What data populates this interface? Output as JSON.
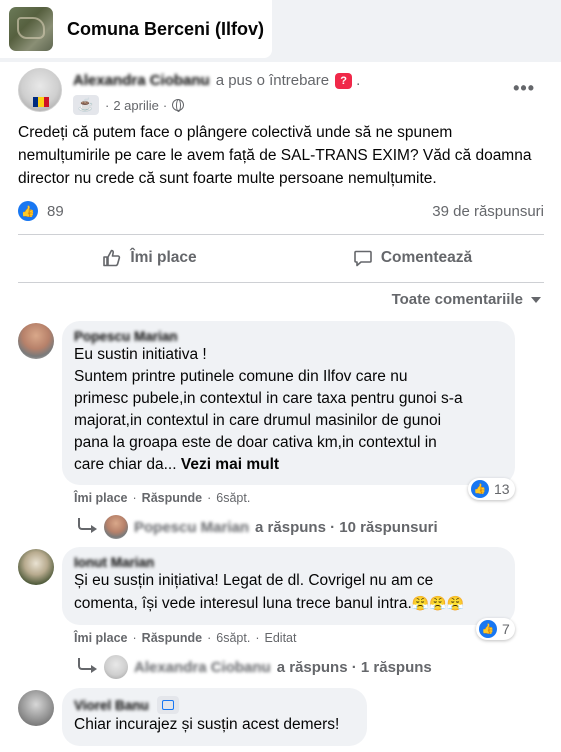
{
  "group": {
    "name": "Comuna Berceni (Ilfov)"
  },
  "post": {
    "author": "Alexandra Ciobanu",
    "action": "a pus o întrebare",
    "question_badge": "?",
    "dot": ".",
    "date": "2 aprilie",
    "text": "Credeți că putem face o plângere colectivă unde să ne spunem nemulțumirile pe care le avem față de SAL-TRANS EXIM? Văd că doamna director nu crede că sunt foarte multe persoane nemulțumite.",
    "likes": "89",
    "replies": "39 de răspunsuri",
    "more_label": "•••"
  },
  "actions": {
    "like": "Îmi place",
    "comment": "Comentează"
  },
  "sort": {
    "label": "Toate comentariile"
  },
  "comments": [
    {
      "author": "Popescu Marian",
      "lines": [
        "Eu sustin initiativa !",
        "Suntem printre putinele comune din Ilfov care nu",
        "primesc pubele,in contextul in care taxa pentru gunoi s-a",
        "majorat,in contextul in care drumul masinilor de gunoi",
        "pana la groapa este de doar cativa km,in contextul in",
        "care chiar da..."
      ],
      "see_more": "Vezi mai mult",
      "like": "Îmi place",
      "reply": "Răspunde",
      "time": "6săpt.",
      "reactions": "13",
      "reply_author": "Popescu Marian",
      "reply_text": "a răspuns · 10 răspunsuri"
    },
    {
      "author": "Ionut Marian",
      "lines": [
        "Și eu susțin inițiativa! Legat de dl. Covrigel nu am ce",
        "comenta, își vede interesul luna trece banul intra."
      ],
      "emojis": "😤😤😤",
      "like": "Îmi place",
      "reply": "Răspunde",
      "time": "6săpt.",
      "edited": "Editat",
      "reactions": "7",
      "reply_author": "Alexandra Ciobanu",
      "reply_text": "a răspuns · 1 răspuns"
    },
    {
      "author": "Viorel Banu",
      "text": "Chiar incurajez și susțin acest demers!"
    }
  ],
  "colors": {
    "accent": "#1877f2",
    "muted": "#65676b",
    "bubble": "#f0f2f5",
    "badge": "#f02849"
  }
}
